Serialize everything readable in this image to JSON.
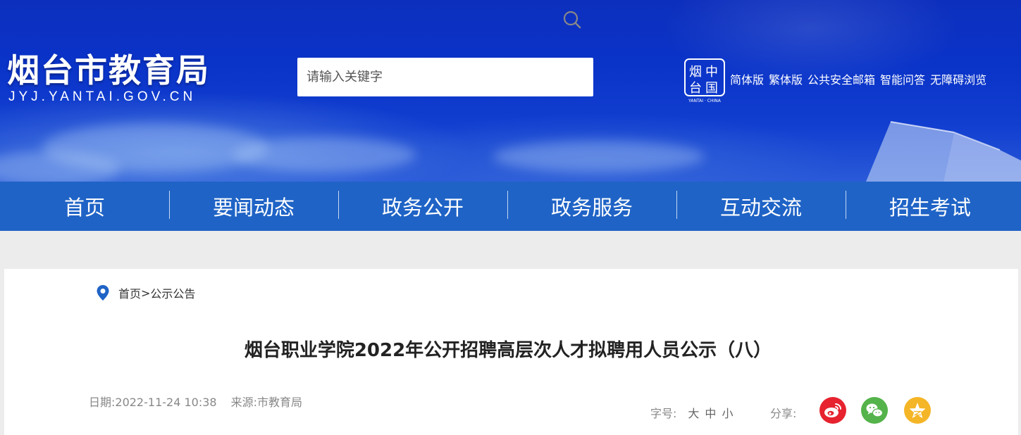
{
  "header": {
    "logo_cn": "烟台市教育局",
    "logo_en": "JYJ.YANTAI.GOV.CN",
    "search_placeholder": "请输入关键字",
    "seal_caption": "YANTAI · CHINA",
    "top_links": [
      "简体版",
      "繁体版",
      "公共安全邮箱",
      "智能问答",
      "无障碍浏览"
    ]
  },
  "nav": {
    "items": [
      "首页",
      "要闻动态",
      "政务公开",
      "政务服务",
      "互动交流",
      "招生考试"
    ]
  },
  "breadcrumb": {
    "home": "首页",
    "separator": ">",
    "current": "公示公告"
  },
  "article": {
    "title": "烟台职业学院2022年公开招聘高层次人才拟聘用人员公示（八）",
    "date": "日期:2022-11-24 10:38",
    "source": "来源:市教育局"
  },
  "tools": {
    "fontsize_label": "字号:",
    "fontsize_options": [
      "大",
      "中",
      "小"
    ],
    "share_label": "分享:"
  },
  "colors": {
    "banner_blue": "#0a33c8",
    "nav_blue": "#1f63c6",
    "weibo": "#e6232f",
    "wechat": "#54b34a",
    "qzone": "#f4b526"
  },
  "icons": [
    "search-icon",
    "location-pin-icon",
    "weibo-icon",
    "wechat-icon",
    "qzone-star-icon"
  ]
}
